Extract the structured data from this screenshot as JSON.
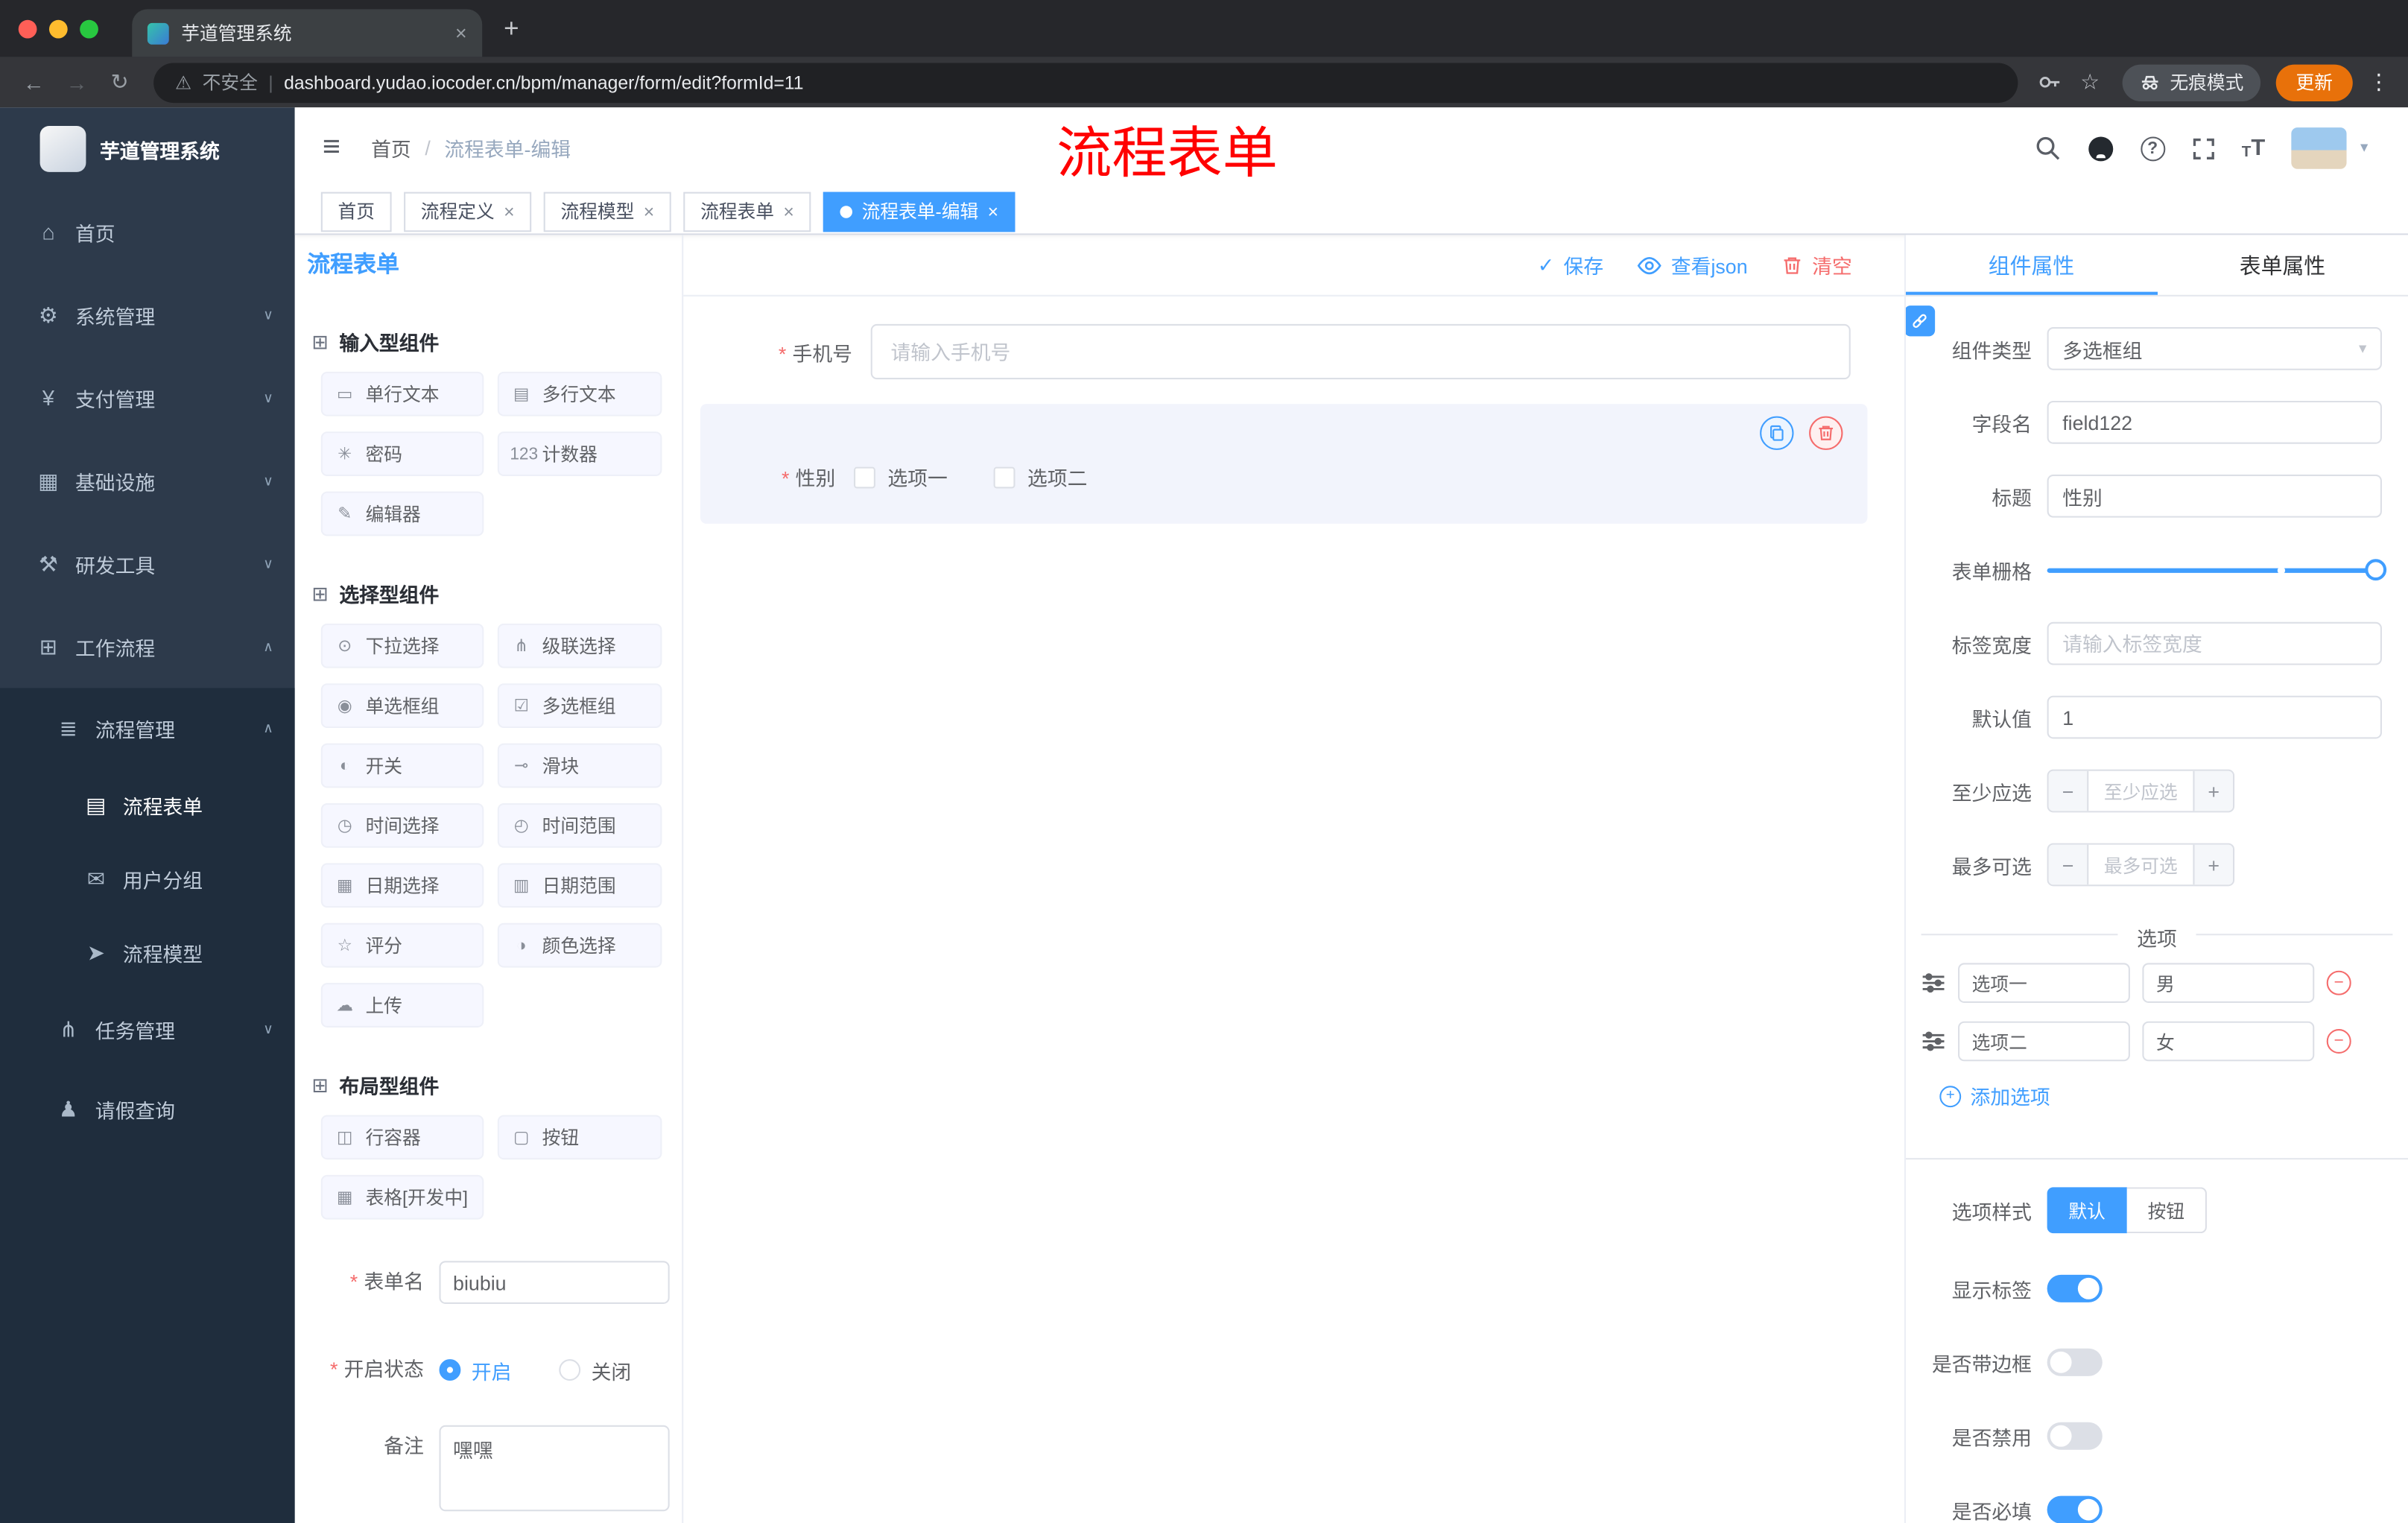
{
  "colors": {
    "accent": "#409eff",
    "danger": "#f56c6c",
    "annotation_red": "#ff0000",
    "sidebar_bg": "#2d3a4b",
    "submenu_bg": "#1f2d3d",
    "tag_active_bg": "#409eff",
    "update_pill": "#e8710a"
  },
  "icons": {
    "close": "×",
    "plus": "+",
    "minus": "−",
    "back": "←",
    "forward": "→",
    "reload": "↻",
    "warning": "⚠",
    "star": "☆",
    "dots": "⋮",
    "hamburger": "≡",
    "check": "✓",
    "caret": "▾",
    "chevron_up": "∧",
    "chevron_down": "∨",
    "question": "?",
    "font_size_large": "T",
    "font_size_small": "T",
    "pipe": "|",
    "slash": "/"
  },
  "browser": {
    "tab_title": "芋道管理系统",
    "security_label": "不安全",
    "url": "dashboard.yudao.iocoder.cn/bpm/manager/form/edit?formId=11",
    "incognito_label": "无痕模式",
    "update_label": "更新"
  },
  "annotation": {
    "text": "流程表单"
  },
  "sidebar": {
    "logo_title": "芋道管理系统",
    "items": [
      {
        "label": "首页",
        "glyph": "⌂"
      },
      {
        "label": "系统管理",
        "glyph": "⚙"
      },
      {
        "label": "支付管理",
        "glyph": "¥"
      },
      {
        "label": "基础设施",
        "glyph": "▦"
      },
      {
        "label": "研发工具",
        "glyph": "⚒"
      },
      {
        "label": "工作流程",
        "glyph": "⊞"
      }
    ],
    "submenu": {
      "process_mgmt": {
        "label": "流程管理",
        "glyph": "≣"
      },
      "children": [
        {
          "label": "流程表单",
          "glyph": "▤"
        },
        {
          "label": "用户分组",
          "glyph": "✉"
        },
        {
          "label": "流程模型",
          "glyph": "➤"
        }
      ],
      "task_mgmt": {
        "label": "任务管理",
        "glyph": "⋔"
      },
      "leave_query": {
        "label": "请假查询",
        "glyph": "♟"
      }
    }
  },
  "header": {
    "breadcrumb_home": "首页",
    "breadcrumb_current": "流程表单-编辑"
  },
  "tags": [
    {
      "label": "首页"
    },
    {
      "label": "流程定义"
    },
    {
      "label": "流程模型"
    },
    {
      "label": "流程表单"
    },
    {
      "label": "流程表单-编辑"
    }
  ],
  "palette": {
    "title": "流程表单",
    "sections": [
      {
        "title": "输入型组件",
        "glyph": "⊞",
        "items": [
          {
            "label": "单行文本",
            "glyph": "▭"
          },
          {
            "label": "多行文本",
            "glyph": "▤"
          },
          {
            "label": "密码",
            "glyph": "✳"
          },
          {
            "label": "计数器",
            "glyph": "123"
          },
          {
            "label": "编辑器",
            "glyph": "✎"
          }
        ]
      },
      {
        "title": "选择型组件",
        "glyph": "⊞",
        "items": [
          {
            "label": "下拉选择",
            "glyph": "⊙"
          },
          {
            "label": "级联选择",
            "glyph": "⋔"
          },
          {
            "label": "单选框组",
            "glyph": "◉"
          },
          {
            "label": "多选框组",
            "glyph": "☑"
          },
          {
            "label": "开关",
            "glyph": "◐"
          },
          {
            "label": "滑块",
            "glyph": "⊸"
          },
          {
            "label": "时间选择",
            "glyph": "◷"
          },
          {
            "label": "时间范围",
            "glyph": "◴"
          },
          {
            "label": "日期选择",
            "glyph": "▦"
          },
          {
            "label": "日期范围",
            "glyph": "▥"
          },
          {
            "label": "评分",
            "glyph": "☆"
          },
          {
            "label": "颜色选择",
            "glyph": "◑"
          },
          {
            "label": "上传",
            "glyph": "☁"
          }
        ]
      },
      {
        "title": "布局型组件",
        "glyph": "⊞",
        "items": [
          {
            "label": "行容器",
            "glyph": "◫"
          },
          {
            "label": "按钮",
            "glyph": "▢"
          },
          {
            "label": "表格[开发中]",
            "glyph": "▦"
          }
        ]
      }
    ],
    "form": {
      "name_label": "表单名",
      "name_value": "biubiu",
      "status_label": "开启状态",
      "status_on": "开启",
      "status_off": "关闭",
      "remark_label": "备注",
      "remark_value": "嘿嘿"
    }
  },
  "canvas": {
    "save_label": "保存",
    "view_json_label": "查看json",
    "clear_label": "清空",
    "phone": {
      "label": "手机号",
      "placeholder": "请输入手机号"
    },
    "gender": {
      "label": "性别",
      "option1": "选项一",
      "option2": "选项二"
    }
  },
  "props": {
    "tab_component": "组件属性",
    "tab_form": "表单属性",
    "component_type_label": "组件类型",
    "component_type_value": "多选框组",
    "field_name_label": "字段名",
    "field_name_value": "field122",
    "title_label": "标题",
    "title_value": "性别",
    "grid_label": "表单栅格",
    "label_width_label": "标签宽度",
    "label_width_placeholder": "请输入标签宽度",
    "default_label": "默认值",
    "default_value": "1",
    "min_label": "至少应选",
    "min_placeholder": "至少应选",
    "max_label": "最多可选",
    "max_placeholder": "最多可选",
    "options_title": "选项",
    "options": [
      {
        "name": "选项一",
        "value": "男"
      },
      {
        "name": "选项二",
        "value": "女"
      }
    ],
    "add_option_label": "添加选项",
    "style_label": "选项样式",
    "style_default": "默认",
    "style_button": "按钮",
    "switch_show_label": "显示标签",
    "switch_border_label": "是否带边框",
    "switch_disabled_label": "是否禁用",
    "switch_required_label": "是否必填"
  }
}
